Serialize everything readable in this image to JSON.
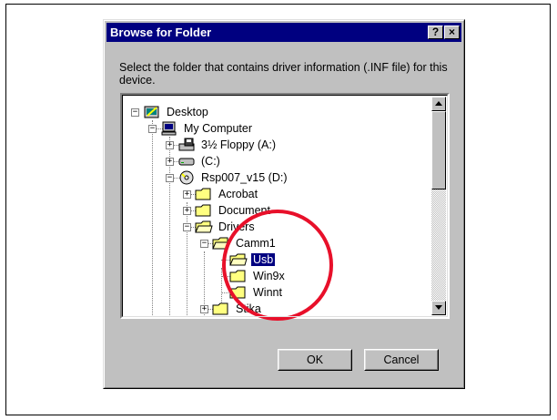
{
  "dialog": {
    "title": "Browse for Folder",
    "help_button": "?",
    "close_button": "×",
    "instruction": "Select the folder that contains driver information (.INF file) for this device."
  },
  "tree": {
    "items": [
      {
        "label": "Desktop",
        "icon": "desktop-icon",
        "expander": "−"
      },
      {
        "label": "My Computer",
        "icon": "computer-icon",
        "expander": "−"
      },
      {
        "label": "3½ Floppy (A:)",
        "icon": "floppy-drive-icon",
        "expander": "+"
      },
      {
        "label": "(C:)",
        "icon": "hard-drive-icon",
        "expander": "+"
      },
      {
        "label": "Rsp007_v15 (D:)",
        "icon": "cd-drive-icon",
        "expander": "−"
      },
      {
        "label": "Acrobat",
        "icon": "folder-icon",
        "expander": "+"
      },
      {
        "label": "Document",
        "icon": "folder-icon",
        "expander": "+"
      },
      {
        "label": "Drivers",
        "icon": "folder-open-icon",
        "expander": "−"
      },
      {
        "label": "Camm1",
        "icon": "folder-open-icon",
        "expander": "−"
      },
      {
        "label": "Usb",
        "icon": "folder-open-icon",
        "selected": true
      },
      {
        "label": "Win9x",
        "icon": "folder-icon"
      },
      {
        "label": "Winnt",
        "icon": "folder-icon"
      },
      {
        "label": "Stika",
        "icon": "folder-icon",
        "expander": "+"
      }
    ]
  },
  "buttons": {
    "ok": "OK",
    "cancel": "Cancel"
  },
  "colors": {
    "titlebar": "#000080",
    "selection": "#000080",
    "annotation_circle": "#e8102a"
  }
}
